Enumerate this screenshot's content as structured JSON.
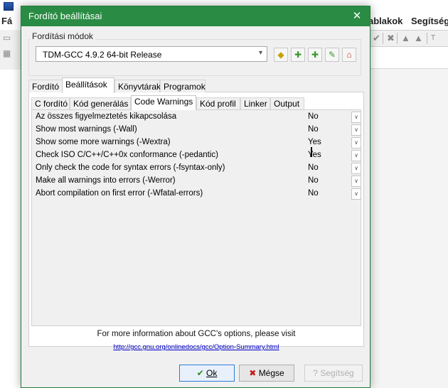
{
  "background_app": {
    "menu_partial_left": "Fá",
    "menu_items": [
      "ablakok",
      "Segítség"
    ],
    "toolbar_glyphs": [
      "✔",
      "✖",
      "▲",
      "▲",
      "T"
    ]
  },
  "dialog": {
    "title": "Fordító beállításai",
    "close_glyph": "✕",
    "compiler_set": {
      "legend": "Fordítási módok",
      "selected": "TDM-GCC 4.9.2 64-bit Release",
      "action_icons": [
        {
          "name": "rename-icon",
          "glyph": "◆",
          "color": "#c8a000"
        },
        {
          "name": "add-icon",
          "glyph": "✚",
          "color": "#3a9a2a"
        },
        {
          "name": "add-folder-icon",
          "glyph": "✚",
          "color": "#3a9a2a"
        },
        {
          "name": "edit-icon",
          "glyph": "✎",
          "color": "#3a9a2a"
        },
        {
          "name": "delete-icon",
          "glyph": "⌂",
          "color": "#c03020"
        }
      ]
    },
    "main_tabs": [
      "Fordító",
      "Beállítások",
      "Könyvtárak",
      "Programok"
    ],
    "main_tab_active": "Beállítások",
    "sub_tabs": [
      "C fordító",
      "Kód generálás",
      "Code Warnings",
      "Kód profil",
      "Linker",
      "Output"
    ],
    "sub_tab_active": "Code Warnings",
    "options": [
      {
        "label": "Az összes figyelmeztetés kikapcsolása",
        "value": "No"
      },
      {
        "label": "Show most warnings (-Wall)",
        "value": "No"
      },
      {
        "label": "Show some more warnings (-Wextra)",
        "value": "Yes"
      },
      {
        "label": "Check ISO C/C++/C++0x conformance (-pedantic)",
        "value": "Yes"
      },
      {
        "label": "Only check the code for syntax errors (-fsyntax-only)",
        "value": "No"
      },
      {
        "label": "Make all warnings into errors (-Werror)",
        "value": "No"
      },
      {
        "label": "Abort compilation on first error (-Wfatal-errors)",
        "value": "No"
      }
    ],
    "info_text": "For more information about GCC's options, please visit",
    "info_link": "http://gcc.gnu.org/onlinedocs/gcc/Option-Summary.html",
    "buttons": {
      "ok_label": "Ok",
      "cancel_label": "Mégse",
      "help_label": "Segítség"
    },
    "colors": {
      "titlebar": "#2a8c44",
      "ok_check": "#2b8a1e",
      "cancel_x": "#c01818"
    }
  }
}
